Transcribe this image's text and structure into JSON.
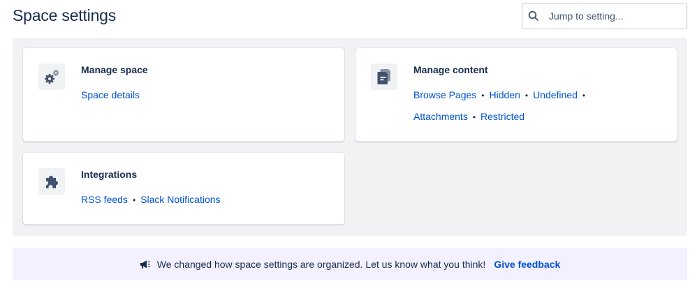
{
  "header": {
    "title": "Space settings",
    "search": {
      "placeholder": "Jump to setting...",
      "value": ""
    }
  },
  "cards": {
    "manage_space": {
      "icon": "gears-icon",
      "title": "Manage space",
      "links": [
        "Space details"
      ]
    },
    "manage_content": {
      "icon": "document-icon",
      "title": "Manage content",
      "links": [
        "Browse Pages",
        "Hidden",
        "Undefined",
        "Attachments",
        "Restricted"
      ]
    },
    "integrations": {
      "icon": "puzzle-piece-icon",
      "title": "Integrations",
      "links": [
        "RSS feeds",
        "Slack Notifications"
      ]
    }
  },
  "banner": {
    "icon": "megaphone-icon",
    "message": "We changed how space settings are organized. Let us know what you think!",
    "feedback_label": "Give feedback"
  },
  "colors": {
    "link": "#0052cc",
    "text": "#172b4d",
    "panel_bg": "#f1f2f4",
    "banner_bg": "#f3f0ff",
    "icon": "#42526e"
  }
}
